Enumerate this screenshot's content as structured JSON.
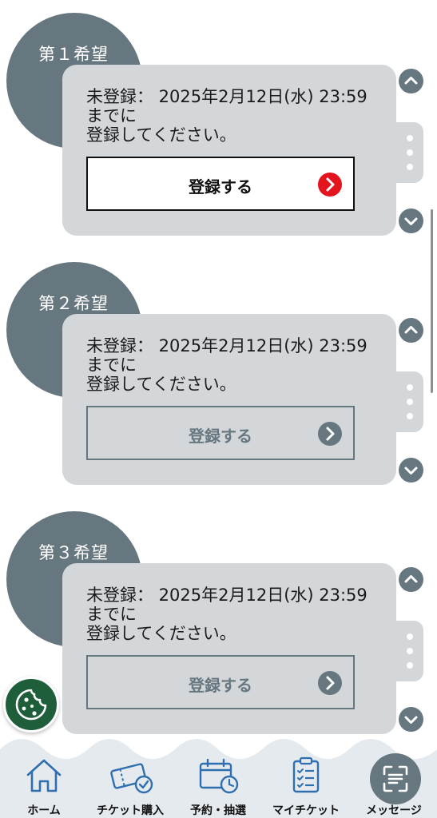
{
  "choices": [
    {
      "title": "第１希望",
      "status_line1": "未登録： 2025年2月12日(水) 23:59",
      "status_line2": "までに",
      "status_line3": "登録してください。",
      "button_label": "登録する",
      "button_state": "active"
    },
    {
      "title": "第２希望",
      "status_line1": "未登録： 2025年2月12日(水) 23:59",
      "status_line2": "までに",
      "status_line3": "登録してください。",
      "button_label": "登録する",
      "button_state": "disabled"
    },
    {
      "title": "第３希望",
      "status_line1": "未登録： 2025年2月12日(水) 23:59",
      "status_line2": "までに",
      "status_line3": "登録してください。",
      "button_label": "登録する",
      "button_state": "disabled"
    }
  ],
  "bottom_nav": {
    "items": [
      {
        "label": "ホーム",
        "icon": "home-icon"
      },
      {
        "label": "チケット購入",
        "icon": "ticket-check-icon"
      },
      {
        "label": "予約・抽選",
        "icon": "calendar-clock-icon"
      },
      {
        "label": "マイチケット",
        "icon": "clipboard-list-icon"
      },
      {
        "label": "メッセージ",
        "icon": "scan-icon"
      }
    ]
  },
  "floating": {
    "icon": "cookie-icon"
  },
  "colors": {
    "accent_slate": "#67777f",
    "card_bg": "#d3d7da",
    "active_arrow": "#e4141e",
    "cookie_green": "#1f5e3b",
    "nav_bg": "#e5eaee",
    "nav_icon": "#2f6fb0"
  }
}
